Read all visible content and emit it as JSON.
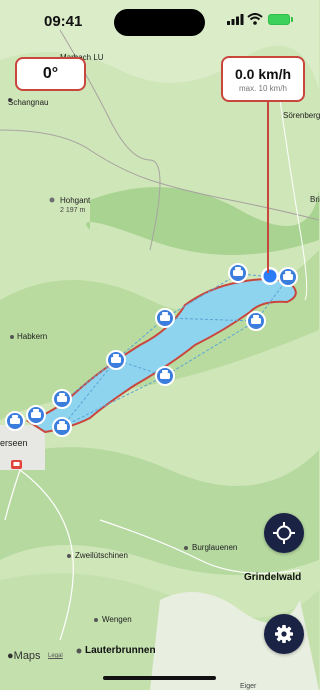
{
  "status_bar": {
    "time": "09:41"
  },
  "heading_card": {
    "value": "0°"
  },
  "speed_card": {
    "value": "0.0 km/h",
    "max": "max. 10 km/h"
  },
  "map_labels": {
    "marbach": "Marbach LU",
    "schangnau": "Schangnau",
    "sorenberg": "Sörenberg",
    "brienz": "Bri",
    "hohgant": "Hohgant",
    "hohgant_elev": "2 197 m",
    "habkern": "Habkern",
    "interlaken": "erseen",
    "zweilutschinen": "Zweilütschinen",
    "burglauenen": "Burglauenen",
    "grindelwald": "Grindelwald",
    "wengen": "Wengen",
    "lauterbrunnen": "Lauterbrunnen",
    "bottom_peak": "Eiger"
  },
  "attribution": {
    "maps": "Maps",
    "legal": "Legal"
  },
  "colors": {
    "lake": "#8fd4ef",
    "route": "#c9463d",
    "ferry_stop": "#3b7ddd",
    "fab": "#1b2345",
    "accent": "#c9463d"
  },
  "icons": {
    "locate": "crosshair-icon",
    "settings": "gear-icon",
    "ferry": "ferry-icon"
  }
}
